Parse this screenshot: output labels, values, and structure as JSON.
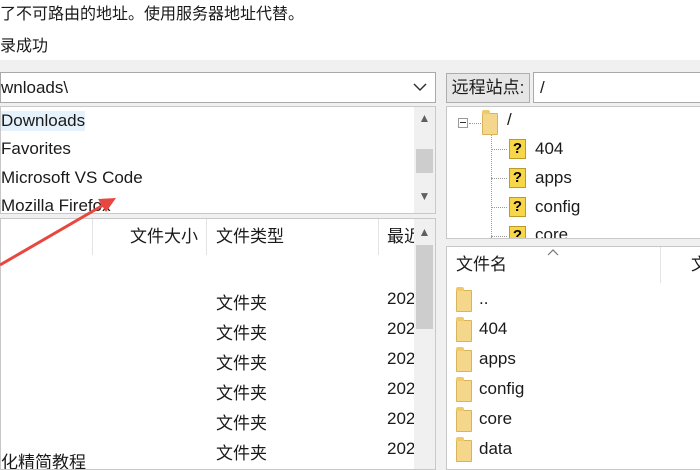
{
  "log": {
    "line1": "了不可路由的地址。使用服务器地址代替。",
    "line2": "录成功"
  },
  "local": {
    "path": "wnloads\\",
    "tree_items": [
      "Downloads",
      "Favorites",
      "Microsoft VS Code",
      "Mozilla Firefox"
    ],
    "columns": {
      "size": "文件大小",
      "type": "文件类型",
      "modified": "最近"
    },
    "rows": [
      {
        "name": "",
        "type": "文件夹",
        "date": "202"
      },
      {
        "name": "",
        "type": "文件夹",
        "date": "202"
      },
      {
        "name": "",
        "type": "文件夹",
        "date": "202"
      },
      {
        "name": "",
        "type": "文件夹",
        "date": "202"
      },
      {
        "name": "",
        "type": "文件夹",
        "date": "202"
      },
      {
        "name": "化精简教程",
        "type": "文件夹",
        "date": "202"
      }
    ]
  },
  "remote": {
    "site_label": "远程站点:",
    "path": "/",
    "tree_root": "/",
    "tree_items": [
      "404",
      "apps",
      "config",
      "core"
    ],
    "list_header": "文件名",
    "list_header_partial": "文",
    "files": [
      "..",
      "404",
      "apps",
      "config",
      "core",
      "data"
    ]
  },
  "annotation": {
    "color": "#e8473f"
  }
}
